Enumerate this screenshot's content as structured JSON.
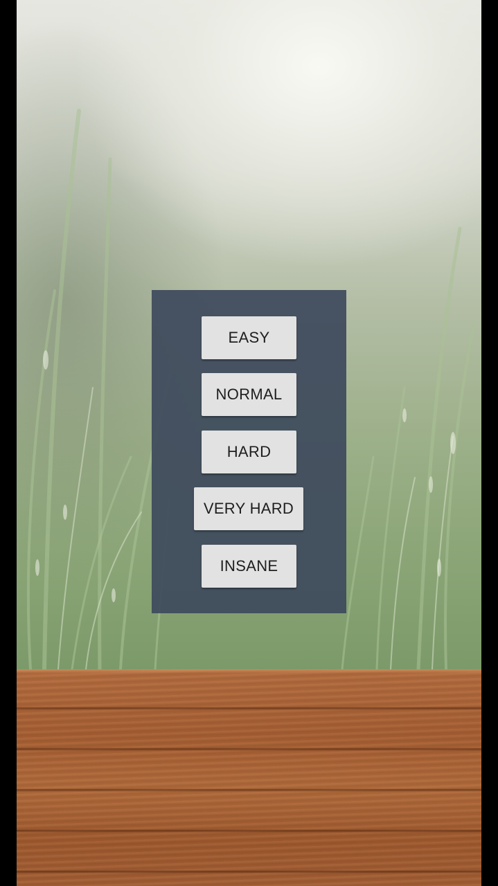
{
  "screen": {
    "background": "grass-meadow",
    "floor": "wooden-planks"
  },
  "difficulty_menu": {
    "buttons": [
      {
        "label": "EASY"
      },
      {
        "label": "NORMAL"
      },
      {
        "label": "HARD"
      },
      {
        "label": "VERY HARD"
      },
      {
        "label": "INSANE"
      }
    ]
  },
  "colors": {
    "panel": "#3e4a5c",
    "button": "#e2e2e2",
    "button_text": "#1e1e1e",
    "wood": "#a35c31"
  }
}
